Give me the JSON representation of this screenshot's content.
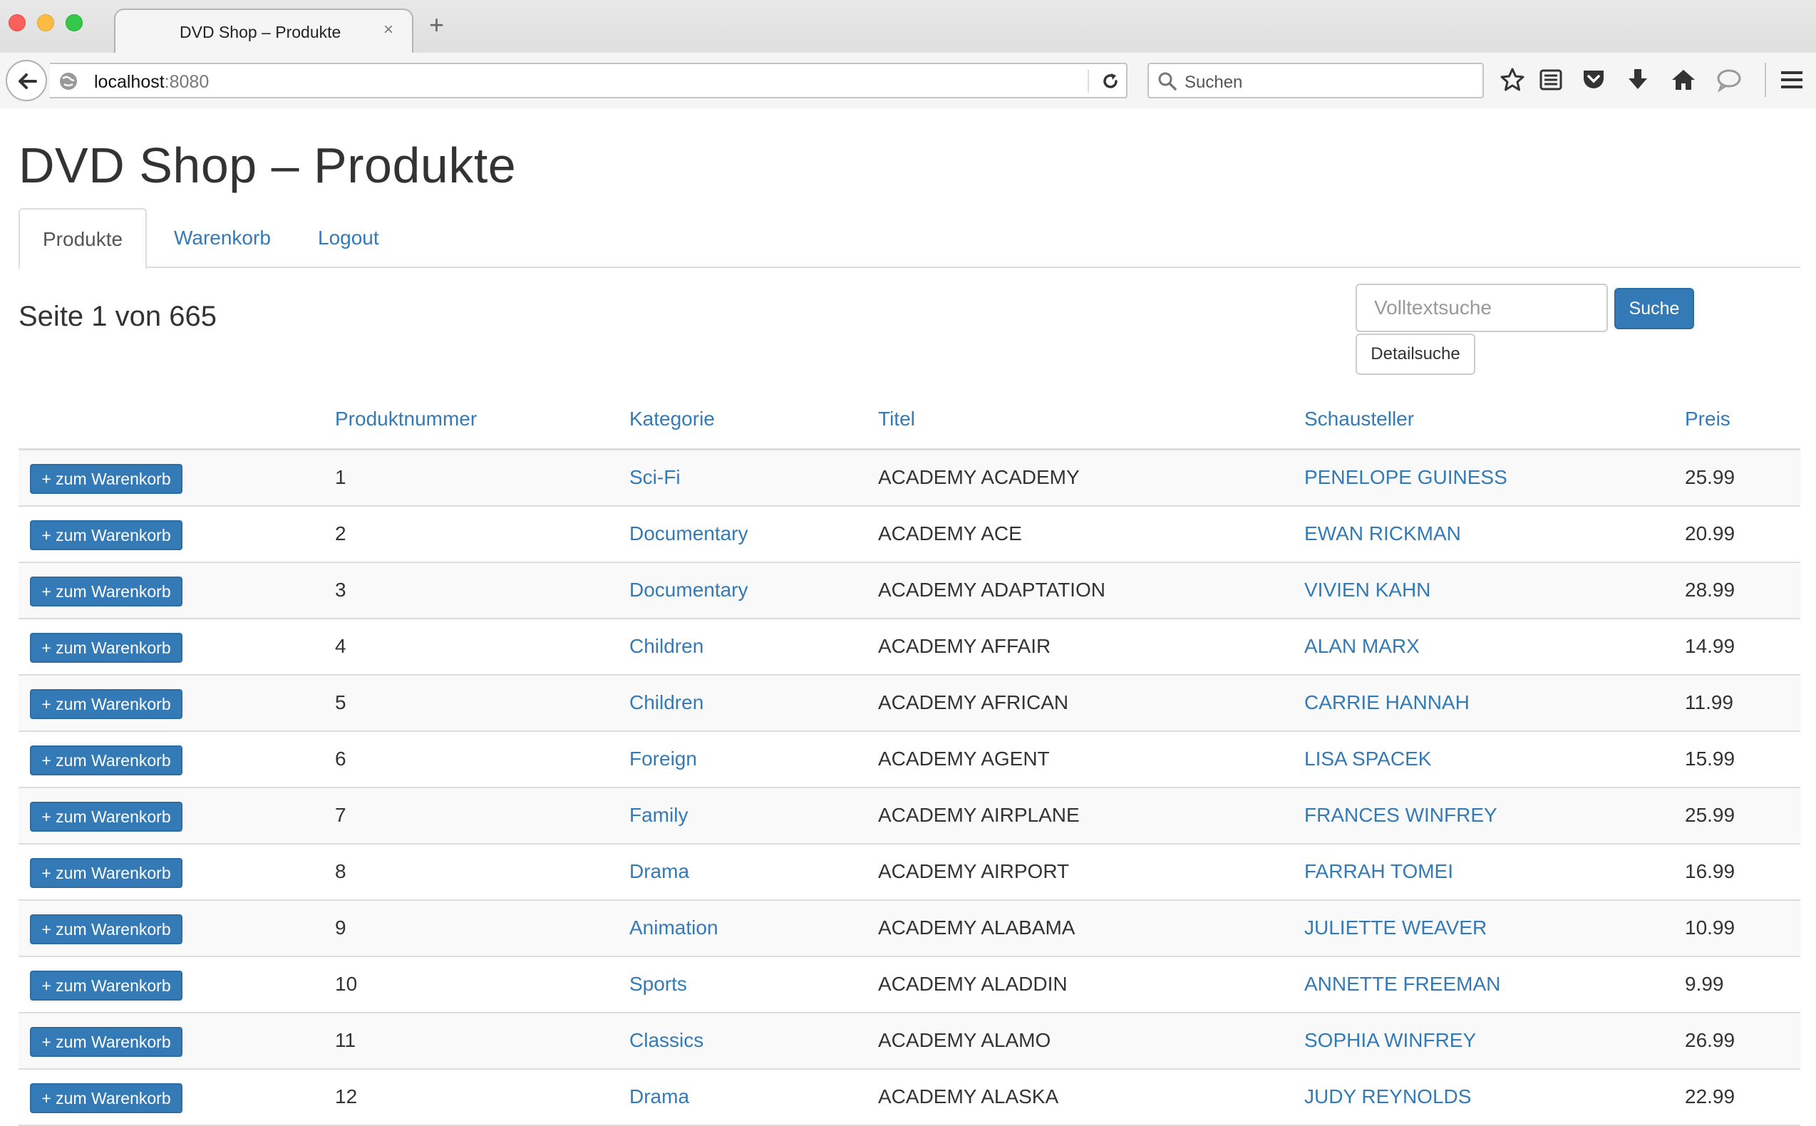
{
  "browser": {
    "tab_title": "DVD Shop – Produkte",
    "tab_close": "×",
    "new_tab": "+",
    "url_host": "localhost",
    "url_port": ":8080",
    "search_placeholder": "Suchen"
  },
  "page": {
    "title": "DVD Shop – Produkte",
    "tabs": [
      {
        "label": "Produkte",
        "active": true
      },
      {
        "label": "Warenkorb",
        "active": false
      },
      {
        "label": "Logout",
        "active": false
      }
    ],
    "page_info": "Seite 1 von 665",
    "search": {
      "placeholder": "Volltextsuche",
      "submit_label": "Suche",
      "detail_label": "Detailsuche"
    }
  },
  "table": {
    "headers": {
      "number": "Produktnummer",
      "category": "Kategorie",
      "title": "Titel",
      "actor": "Schausteller",
      "price": "Preis"
    },
    "cart_label": "+ zum Warenkorb",
    "rows": [
      {
        "number": "1",
        "category": "Sci-Fi",
        "title": "ACADEMY ACADEMY",
        "actor": "PENELOPE GUINESS",
        "price": "25.99"
      },
      {
        "number": "2",
        "category": "Documentary",
        "title": "ACADEMY ACE",
        "actor": "EWAN RICKMAN",
        "price": "20.99"
      },
      {
        "number": "3",
        "category": "Documentary",
        "title": "ACADEMY ADAPTATION",
        "actor": "VIVIEN KAHN",
        "price": "28.99"
      },
      {
        "number": "4",
        "category": "Children",
        "title": "ACADEMY AFFAIR",
        "actor": "ALAN MARX",
        "price": "14.99"
      },
      {
        "number": "5",
        "category": "Children",
        "title": "ACADEMY AFRICAN",
        "actor": "CARRIE HANNAH",
        "price": "11.99"
      },
      {
        "number": "6",
        "category": "Foreign",
        "title": "ACADEMY AGENT",
        "actor": "LISA SPACEK",
        "price": "15.99"
      },
      {
        "number": "7",
        "category": "Family",
        "title": "ACADEMY AIRPLANE",
        "actor": "FRANCES WINFREY",
        "price": "25.99"
      },
      {
        "number": "8",
        "category": "Drama",
        "title": "ACADEMY AIRPORT",
        "actor": "FARRAH TOMEI",
        "price": "16.99"
      },
      {
        "number": "9",
        "category": "Animation",
        "title": "ACADEMY ALABAMA",
        "actor": "JULIETTE WEAVER",
        "price": "10.99"
      },
      {
        "number": "10",
        "category": "Sports",
        "title": "ACADEMY ALADDIN",
        "actor": "ANNETTE FREEMAN",
        "price": "9.99"
      },
      {
        "number": "11",
        "category": "Classics",
        "title": "ACADEMY ALAMO",
        "actor": "SOPHIA WINFREY",
        "price": "26.99"
      },
      {
        "number": "12",
        "category": "Drama",
        "title": "ACADEMY ALASKA",
        "actor": "JUDY REYNOLDS",
        "price": "22.99"
      }
    ]
  },
  "colors": {
    "link": "#337ab7",
    "primary_button": "#337ab7",
    "text": "#333333",
    "border": "#dddddd"
  },
  "icons": [
    "back-arrow-icon",
    "globe-icon",
    "reload-icon",
    "search-icon",
    "bookmark-star-icon",
    "reading-list-icon",
    "pocket-icon",
    "download-icon",
    "home-icon",
    "chat-icon",
    "hamburger-menu-icon"
  ]
}
